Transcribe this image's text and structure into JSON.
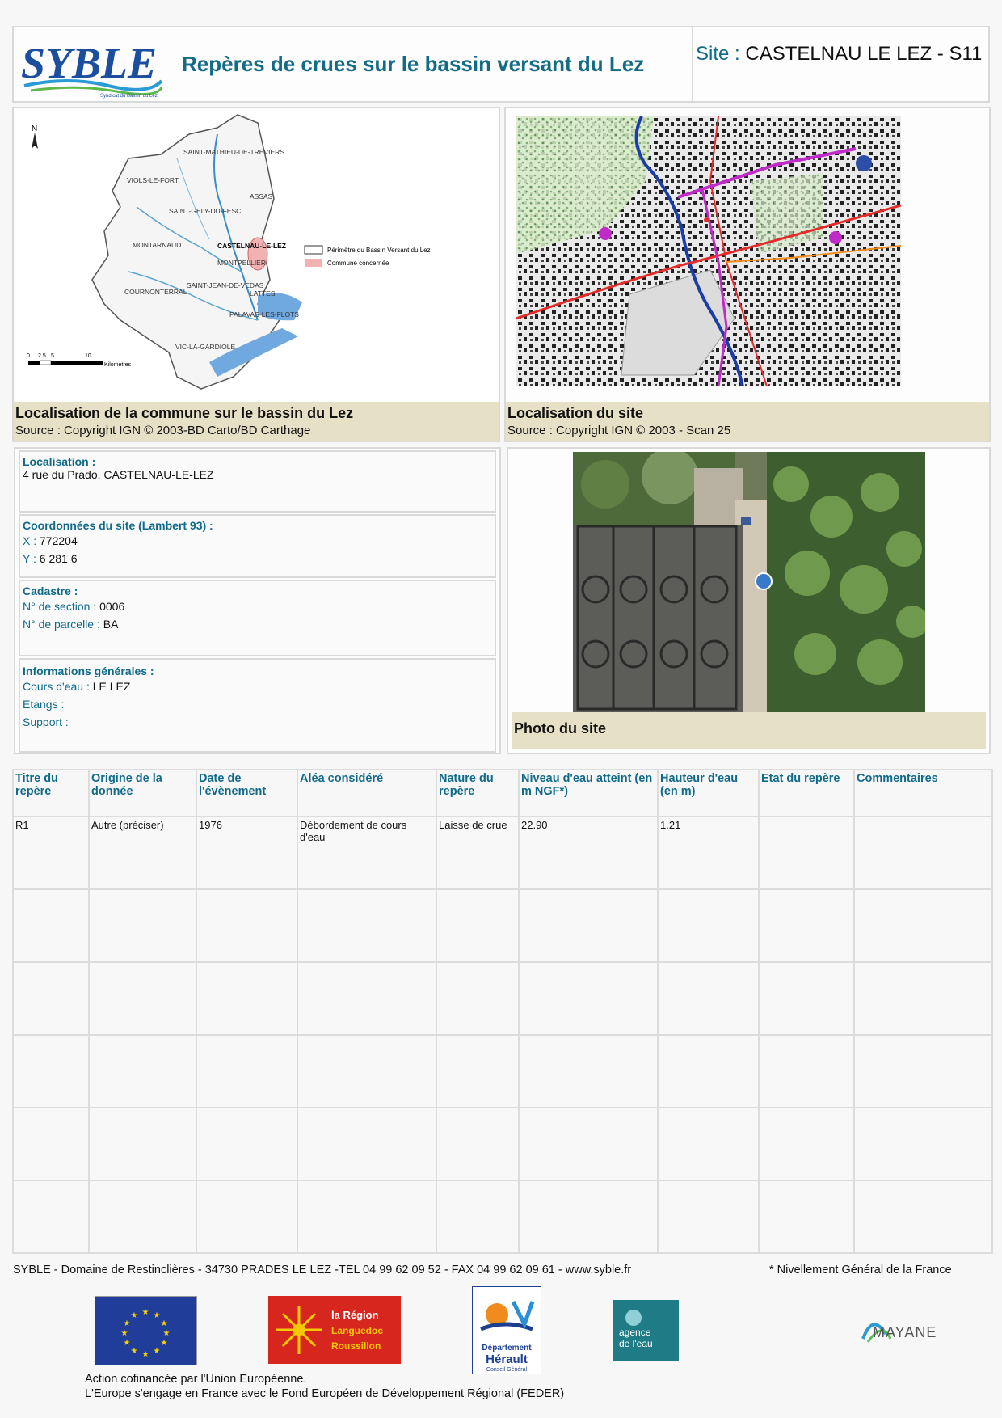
{
  "header": {
    "logo_text": "SYBLE",
    "logo_subtitle": "Syndicat du Bassin du Lez",
    "title": "Repères de crues sur le bassin versant du Lez",
    "site_label": "Site :",
    "site_value": "CASTELNAU LE LEZ - S11"
  },
  "map_left": {
    "north_label": "N",
    "towns": [
      "SAINT-MATHIEU-DE-TREVIERS",
      "VIOLS-LE-FORT",
      "ASSAS",
      "SAINT-GELY-DU-FESC",
      "MONTARNAUD",
      "CASTELNAU-LE-LEZ",
      "MONTPELLIER",
      "SAINT-JEAN-DE-VEDAS",
      "COURNONTERRAL",
      "LATTES",
      "PALAVAS-LES-FLOTS",
      "VIC-LA-GARDIOLE"
    ],
    "legend": [
      "Périmètre du Bassin Versant du Lez",
      "Commune concernée"
    ],
    "scale": [
      "0",
      "2.5",
      "5",
      "10",
      "Kilomètres"
    ],
    "caption_title": "Localisation de la commune sur le bassin du Lez",
    "caption_source": "Source : Copyright IGN © 2003-BD Carto/BD Carthage"
  },
  "map_right": {
    "caption_title": "Localisation du site",
    "caption_source": "Source : Copyright IGN © 2003 - Scan 25"
  },
  "info": {
    "loc_heading": "Localisation :",
    "loc_value": "4 rue du Prado, CASTELNAU-LE-LEZ",
    "coord_heading": "Coordonnées du site (Lambert 93) :",
    "x_label": "X :",
    "x_value": "772204",
    "y_label": "Y :",
    "y_value": "6 281 6",
    "cad_heading": "Cadastre :",
    "section_label": "N° de section :",
    "section_value": "0006",
    "parcelle_label": "N° de parcelle :",
    "parcelle_value": "BA",
    "gen_heading": "Informations générales :",
    "cours_label": "Cours d'eau :",
    "cours_value": "LE LEZ",
    "etangs_label": "Etangs :",
    "support_label": "Support :"
  },
  "photo": {
    "caption": "Photo du site"
  },
  "table": {
    "headers": [
      "Titre du repère",
      "Origine de la donnée",
      "Date de l'évènement",
      "Aléa considéré",
      "Nature du repère",
      "Niveau d'eau atteint (en m NGF*)",
      "Hauteur d'eau (en m)",
      "Etat du repère",
      "Commentaires"
    ],
    "rows": [
      [
        "R1",
        "Autre (préciser)",
        "1976",
        "Débordement de cours d'eau",
        "Laisse de crue",
        "22.90",
        "1.21",
        "",
        ""
      ],
      [
        "",
        "",
        "",
        "",
        "",
        "",
        "",
        "",
        ""
      ],
      [
        "",
        "",
        "",
        "",
        "",
        "",
        "",
        "",
        ""
      ],
      [
        "",
        "",
        "",
        "",
        "",
        "",
        "",
        "",
        ""
      ],
      [
        "",
        "",
        "",
        "",
        "",
        "",
        "",
        "",
        ""
      ],
      [
        "",
        "",
        "",
        "",
        "",
        "",
        "",
        "",
        ""
      ]
    ]
  },
  "footer": {
    "address": "SYBLE - Domaine de Restinclières - 34730 PRADES LE LEZ -TEL 04 99 62 09 52 - FAX 04 99 62 09 61 - www.syble.fr",
    "note": "* Nivellement Général de la France",
    "region_logo": [
      "la Région",
      "Languedoc",
      "Roussillon"
    ],
    "dept_logo": [
      "Département",
      "Hérault",
      "Conseil Général"
    ],
    "agence_logo": [
      "agence",
      "de l'eau"
    ],
    "mayane_logo": "MAYANE",
    "cofin_1": "Action cofinancée par l'Union Européenne.",
    "cofin_2": "L'Europe s'engage en France avec le Fond Européen de Développement Régional (FEDER)"
  },
  "colors": {
    "heading_blue": "#0f6a8a",
    "caption_bg": "#e6e1c6",
    "border": "#d9d9d9"
  }
}
